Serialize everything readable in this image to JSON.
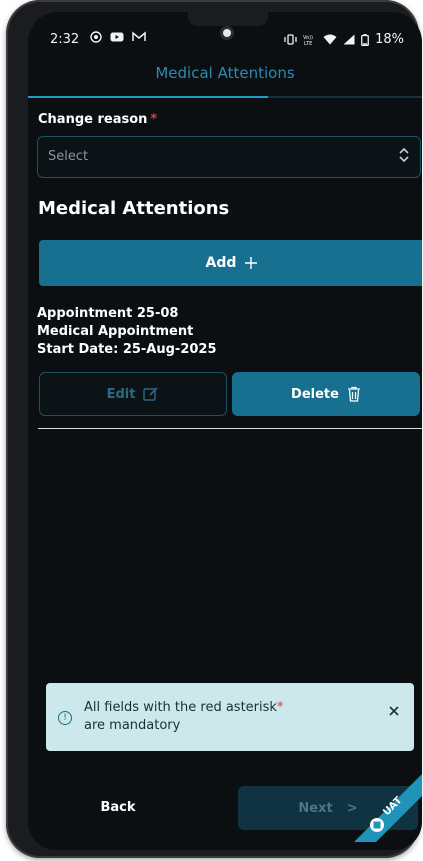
{
  "status_bar": {
    "time": "2:32",
    "left_icons": [
      "target-icon",
      "youtube-icon",
      "gmail-icon"
    ],
    "right_icons": [
      "vibrate-icon",
      "volte-icon",
      "wifi-icon",
      "signal-icon",
      "battery-icon"
    ],
    "battery": "18%"
  },
  "header": {
    "title": "Medical Attentions"
  },
  "form": {
    "change_reason_label": "Change reason",
    "required_mark": "*",
    "select_value": "Select"
  },
  "section": {
    "title": "Medical Attentions",
    "add_label": "Add"
  },
  "appointment": {
    "name": "Appointment 25-08",
    "type": "Medical Appointment",
    "start_date": "Start Date: 25-Aug-2025",
    "edit_label": "Edit",
    "delete_label": "Delete"
  },
  "toast": {
    "message_line1": "All fields with the red asterisk",
    "asterisk": "*",
    "message_line2": "are mandatory"
  },
  "footer": {
    "back_label": "Back",
    "next_label": "Next",
    "next_arrow": ">",
    "badge": "UAT"
  },
  "colors": {
    "accent": "#17708f",
    "header_title": "#2a8bb0",
    "required": "#e23b3b",
    "toast_bg": "#cde8ea",
    "background": "#0c0f12"
  }
}
